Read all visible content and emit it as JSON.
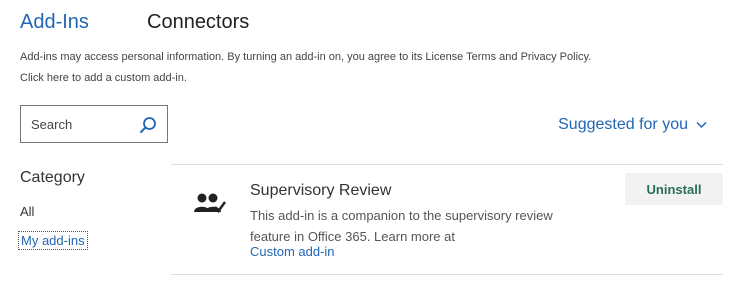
{
  "tabs": [
    {
      "label": "Add-Ins"
    },
    {
      "label": "Connectors"
    }
  ],
  "info": {
    "line1": "Add-ins may access personal information. By turning an add-in on, you agree to its License Terms and Privacy Policy.",
    "line2": "Click here to add a custom add-in."
  },
  "search": {
    "placeholder": "Search",
    "value": "",
    "icon": "search-icon"
  },
  "filter": {
    "label": "Suggested for you",
    "icon": "chevron-down-icon"
  },
  "category": {
    "title": "Category",
    "items": [
      {
        "label": "All"
      },
      {
        "label": "My add-ins"
      }
    ]
  },
  "addin": {
    "icon": "users-check-icon",
    "name": "Supervisory Review",
    "description": "This add-in is a companion to the supervisory review feature in Office 365. Learn more at",
    "link": "Custom add-in",
    "action_label": "Uninstall"
  },
  "colors": {
    "accent": "#2266b5",
    "action_text": "#2a6e5a",
    "button_bg": "#f2f2f2"
  }
}
